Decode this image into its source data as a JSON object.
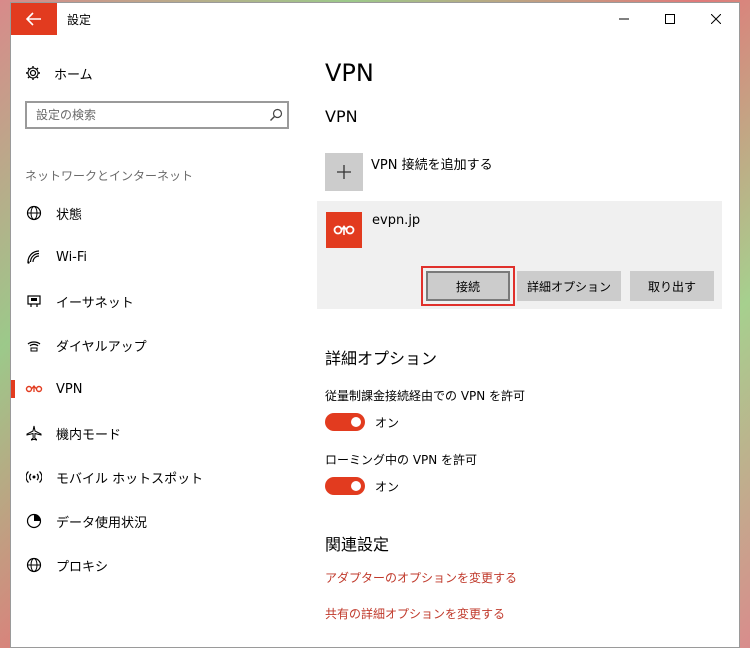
{
  "window": {
    "title": "設定",
    "controls": [
      "minimize",
      "maximize",
      "close"
    ]
  },
  "sidebar": {
    "home_label": "ホーム",
    "search_placeholder": "設定の検索",
    "section_label": "ネットワークとインターネット",
    "items": [
      {
        "label": "状態",
        "icon": "globe-status-icon"
      },
      {
        "label": "Wi-Fi",
        "icon": "wifi-icon"
      },
      {
        "label": "イーサネット",
        "icon": "ethernet-icon"
      },
      {
        "label": "ダイヤルアップ",
        "icon": "dialup-icon"
      },
      {
        "label": "VPN",
        "icon": "vpn-icon",
        "active": true
      },
      {
        "label": "機内モード",
        "icon": "airplane-icon"
      },
      {
        "label": "モバイル ホットスポット",
        "icon": "hotspot-icon"
      },
      {
        "label": "データ使用状況",
        "icon": "data-usage-icon"
      },
      {
        "label": "プロキシ",
        "icon": "proxy-globe-icon"
      }
    ]
  },
  "main": {
    "title": "VPN",
    "subtitle": "VPN",
    "add_vpn_label": "VPN 接続を追加する",
    "connection": {
      "name": "evpn.jp",
      "buttons": {
        "connect": "接続",
        "advanced": "詳細オプション",
        "remove": "取り出す"
      }
    },
    "advanced_section": {
      "title": "詳細オプション",
      "options": [
        {
          "label": "従量制課金接続経由での VPN を許可",
          "state": "オン"
        },
        {
          "label": "ローミング中の VPN を許可",
          "state": "オン"
        }
      ]
    },
    "related_section": {
      "title": "関連設定",
      "links": [
        "アダプターのオプションを変更する",
        "共有の詳細オプションを変更する"
      ]
    }
  },
  "colors": {
    "accent": "#e23b1f",
    "link": "#c0392b",
    "highlight_outline": "#e0302b"
  }
}
